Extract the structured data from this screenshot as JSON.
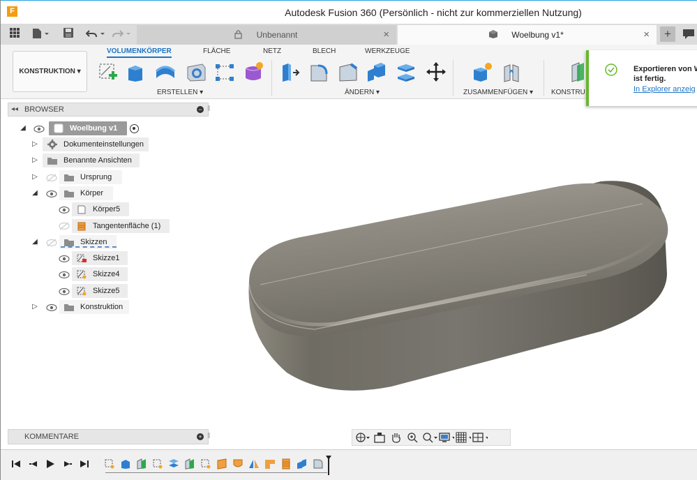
{
  "window": {
    "app_icon": "F",
    "title": "Autodesk Fusion 360 (Persönlich - nicht zur kommerziellen Nutzung)"
  },
  "tabs": [
    {
      "label": "Unbenannt",
      "icon": "lock-icon",
      "active": false,
      "close": "×"
    },
    {
      "label": "Woelbung v1*",
      "icon": "cube-icon",
      "active": true,
      "close": "×"
    }
  ],
  "tabbar": {
    "plus": "+"
  },
  "workspace": {
    "label": "KONSTRUKTION ▾"
  },
  "ribbon": {
    "tabs": [
      "VOLUMENKÖRPER",
      "FLÄCHE",
      "NETZ",
      "BLECH",
      "WERKZEUGE"
    ],
    "active_tab": "VOLUMENKÖRPER",
    "groups": [
      "ERSTELLEN ▾",
      "ÄNDERN ▾",
      "ZUSAMMENFÜGEN ▾",
      "KONSTRU"
    ]
  },
  "toast": {
    "message": "Exportieren von W\nist fertig.",
    "link": "In Explorer anzeig"
  },
  "browser": {
    "title": "BROWSER",
    "arrows": "◂◂",
    "minus": "−",
    "root": "Woelbung v1",
    "items": {
      "dokument": "Dokumenteinstellungen",
      "ansichten": "Benannte Ansichten",
      "ursprung": "Ursprung",
      "koerper": "Körper",
      "koerper5": "Körper5",
      "tangente": "Tangentenfläche (1)",
      "skizzen": "Skizzen",
      "skizze1": "Skizze1",
      "skizze4": "Skizze4",
      "skizze5": "Skizze5",
      "konstruktion": "Konstruktion"
    }
  },
  "comments": {
    "title": "KOMMENTARE",
    "plus": "+"
  },
  "colors": {
    "accent": "#1a73c7",
    "success": "#66b82d",
    "body": "#7a776f",
    "folder": "#8c8c8c"
  }
}
